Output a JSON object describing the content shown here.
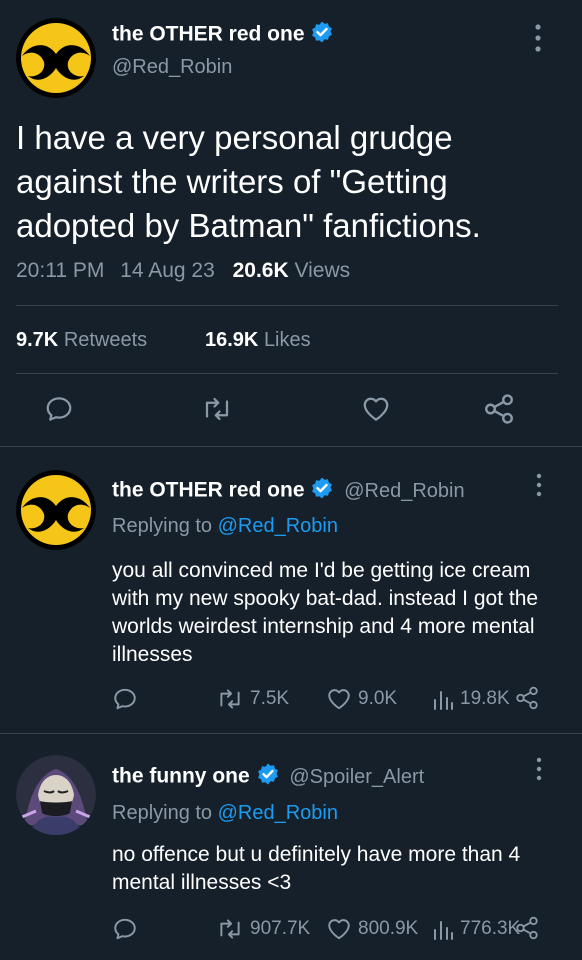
{
  "main_tweet": {
    "display_name": "the OTHER red one",
    "handle": "@Red_Robin",
    "text": "I have a very personal grudge against the writers of \"Getting adopted by Batman\" fanfictions.",
    "time": "20:11 PM",
    "date": "14 Aug 23",
    "views_count": "20.6K",
    "views_label": "Views",
    "retweets_count": "9.7K",
    "retweets_label": "Retweets",
    "likes_count": "16.9K",
    "likes_label": "Likes"
  },
  "replies": [
    {
      "display_name": "the OTHER red one",
      "handle": "@Red_Robin",
      "replying_to_label": "Replying to",
      "replying_to_handle": "@Red_Robin",
      "text": "you all convinced me I'd be getting ice cream with my new spooky bat-dad. instead I got the worlds weirdest internship and 4 more mental illnesses",
      "retweets": "7.5K",
      "likes": "9.0K",
      "views": "19.8K"
    },
    {
      "display_name": "the funny one",
      "handle": "@Spoiler_Alert",
      "replying_to_label": "Replying to",
      "replying_to_handle": "@Red_Robin",
      "text": "no offence but u definitely have more than 4 mental illnesses <3",
      "retweets": "907.7K",
      "likes": "800.9K",
      "views": "776.3K"
    }
  ],
  "colors": {
    "background": "#15202b",
    "accent": "#1d9bf0",
    "muted": "#8b98a5",
    "divider": "#38444d",
    "avatar_yellow": "#f5c518"
  },
  "icons": [
    "more-icon",
    "verified-badge-icon",
    "reply-icon",
    "retweet-icon",
    "like-icon",
    "share-icon",
    "views-icon"
  ]
}
